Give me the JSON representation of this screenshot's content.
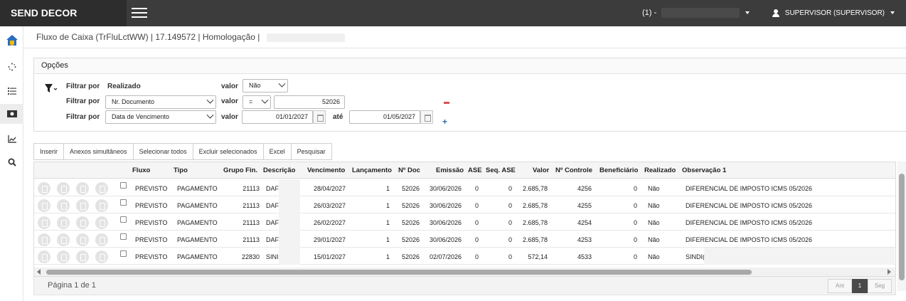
{
  "app": {
    "brand": "SEND DECOR"
  },
  "topbar": {
    "company_label": "(1) -",
    "user_label": "SUPERVISOR (SUPERVISOR)"
  },
  "header": {
    "title": "Fluxo de Caixa (TrFluLctWW) | 17.149572 | Homologação |"
  },
  "options": {
    "title": "Opções",
    "filters": [
      {
        "label": "Filtrar por",
        "field": "Realizado",
        "value_label": "valor",
        "operator": "",
        "value": "Não"
      },
      {
        "label": "Filtrar por",
        "field": "Nr. Documento",
        "value_label": "valor",
        "operator": "=",
        "value": "52026"
      },
      {
        "label": "Filtrar por",
        "field": "Data de Vencimento",
        "value_label": "valor",
        "from": "01/01/2027",
        "until_label": "até",
        "to": "01/05/2027"
      }
    ]
  },
  "toolbar": [
    "Inserir",
    "Anexos simultâneos",
    "Selecionar todos",
    "Excluir selecionados",
    "Excel",
    "Pesquisar"
  ],
  "grid": {
    "columns": [
      "Fluxo",
      "Tipo",
      "Grupo Fin.",
      "Descrição",
      "Vencimento",
      "Lançamento",
      "Nº Doc",
      "Emissão",
      "ASE",
      "Seq. ASE",
      "Valor",
      "Nº Controle",
      "Beneficiário",
      "Realizado",
      "Observação 1"
    ],
    "rows": [
      [
        "PREVISTO",
        "PAGAMENTO",
        "21113",
        "DAF",
        "28/04/2027",
        "1",
        "52026",
        "30/06/2026",
        "0",
        "0",
        "2.685,78",
        "4256",
        "0",
        "Não",
        "DIFERENCIAL DE IMPOSTO ICMS 05/2026"
      ],
      [
        "PREVISTO",
        "PAGAMENTO",
        "21113",
        "DAF",
        "26/03/2027",
        "1",
        "52026",
        "30/06/2026",
        "0",
        "0",
        "2.685,78",
        "4255",
        "0",
        "Não",
        "DIFERENCIAL DE IMPOSTO ICMS 05/2026"
      ],
      [
        "PREVISTO",
        "PAGAMENTO",
        "21113",
        "DAF",
        "26/02/2027",
        "1",
        "52026",
        "30/06/2026",
        "0",
        "0",
        "2.685,78",
        "4254",
        "0",
        "Não",
        "DIFERENCIAL DE IMPOSTO ICMS 05/2026"
      ],
      [
        "PREVISTO",
        "PAGAMENTO",
        "21113",
        "DAF",
        "29/01/2027",
        "1",
        "52026",
        "30/06/2026",
        "0",
        "0",
        "2.685,78",
        "4253",
        "0",
        "Não",
        "DIFERENCIAL DE IMPOSTO ICMS 05/2026"
      ],
      [
        "PREVISTO",
        "PAGAMENTO",
        "22830",
        "SINI",
        "15/01/2027",
        "1",
        "52026",
        "02/07/2026",
        "0",
        "0",
        "572,14",
        "4533",
        "0",
        "Não",
        "SINDI("
      ]
    ]
  },
  "pager": {
    "text": "Página 1 de 1",
    "prev": "Ant",
    "current": "1",
    "next": "Seg"
  },
  "colors": {
    "topbar": "#3c3c3c",
    "brand_bg": "#2d2d2d",
    "accent_blue": "#2a6dbf",
    "minus_red": "#d9534f"
  }
}
